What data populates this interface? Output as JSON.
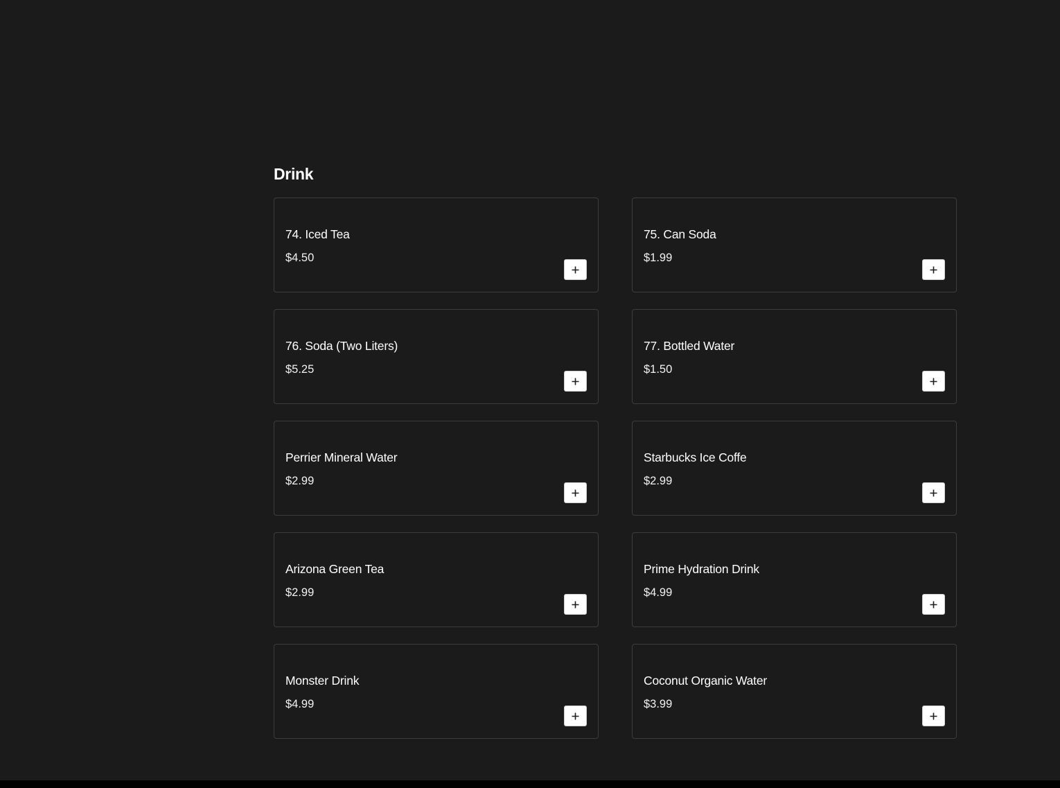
{
  "section": {
    "title": "Drink"
  },
  "items": [
    {
      "name": "74. Iced Tea",
      "price": "$4.50"
    },
    {
      "name": "75. Can Soda",
      "price": "$1.99"
    },
    {
      "name": "76. Soda (Two Liters)",
      "price": "$5.25"
    },
    {
      "name": "77. Bottled Water",
      "price": "$1.50"
    },
    {
      "name": "Perrier Mineral Water",
      "price": "$2.99"
    },
    {
      "name": "Starbucks Ice Coffe",
      "price": "$2.99"
    },
    {
      "name": "Arizona Green Tea",
      "price": "$2.99"
    },
    {
      "name": "Prime Hydration Drink",
      "price": "$4.99"
    },
    {
      "name": "Monster Drink",
      "price": "$4.99"
    },
    {
      "name": "Coconut Organic Water",
      "price": "$3.99"
    }
  ],
  "icons": {
    "add": "plus-icon"
  },
  "colors": {
    "background": "#1b1b1b",
    "card_border": "#3d3d3d",
    "button_bg": "#ffffff",
    "text": "#ffffff"
  }
}
